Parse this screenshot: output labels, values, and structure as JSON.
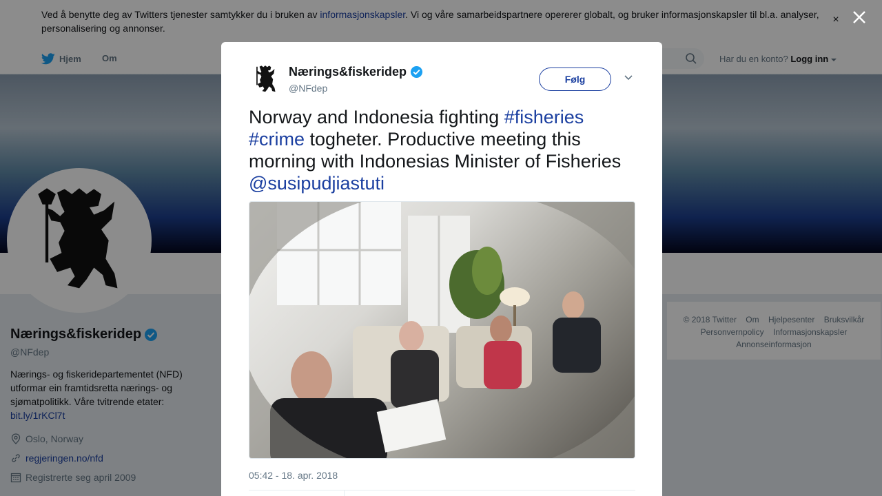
{
  "cookie_banner": {
    "text_before": "Ved å benytte deg av Twitters tjenester samtykker du i bruken av ",
    "link": "informasjonskapsler",
    "text_after": ". Vi og våre samarbeidspartnere opererer globalt, og bruker informasjonskapsler til bl.a. analyser, personalisering og annonser.",
    "close": "×"
  },
  "nav": {
    "home": "Hjem",
    "about": "Om",
    "login_prompt": "Har du en konto?",
    "login": "Logg inn"
  },
  "profile": {
    "name": "Nærings&fiskeridep",
    "handle": "@NFdep",
    "bio": "Nærings- og fiskeridepartementet (NFD) utformar ein framtidsretta nærings- og sjømatpolitikk. Våre tvitrende etater: ",
    "bio_link": "bit.ly/1rKCl7t",
    "location": "Oslo, Norway",
    "website": "regjeringen.no/nfd",
    "joined": "Registrerte seg april 2009"
  },
  "footer": {
    "copyright": "© 2018 Twitter",
    "about": "Om",
    "help": "Hjelpesenter",
    "terms": "Bruksvilkår",
    "privacy": "Personvernpolicy",
    "cookies": "Informasjonskapsler",
    "ads": "Annonseinformasjon"
  },
  "tweet": {
    "name": "Nærings&fiskeridep",
    "handle": "@NFdep",
    "follow": "Følg",
    "text_1": "Norway and Indonesia fighting ",
    "hashtag_1": "#fisheries",
    "hashtag_2": "#crime",
    "text_2": " togheter. Productive meeting this morning with Indonesias Minister of Fisheries ",
    "mention": "@susipudjiastuti",
    "timestamp": "05:42 - 18. apr. 2018"
  },
  "colors": {
    "link": "#1b3fa0",
    "verified": "#1da1f2",
    "text_secondary": "#657786"
  }
}
